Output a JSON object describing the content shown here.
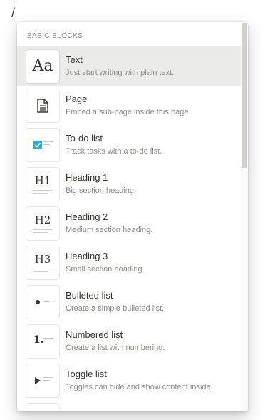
{
  "editor": {
    "typed_text": "/"
  },
  "menu": {
    "section_label": "BASIC BLOCKS",
    "items": [
      {
        "title": "Text",
        "description": "Just start writing with plain text.",
        "icon": "text-block-icon",
        "glyph": "Aa",
        "selected": true
      },
      {
        "title": "Page",
        "description": "Embed a sub-page inside this page.",
        "icon": "page-icon",
        "selected": false
      },
      {
        "title": "To-do list",
        "description": "Track tasks with a to-do list.",
        "icon": "checkbox-icon",
        "selected": false
      },
      {
        "title": "Heading 1",
        "description": "Big section heading.",
        "icon": "heading-1-icon",
        "glyph": "H1",
        "selected": false
      },
      {
        "title": "Heading 2",
        "description": "Medium section heading.",
        "icon": "heading-2-icon",
        "glyph": "H2",
        "selected": false
      },
      {
        "title": "Heading 3",
        "description": "Small section heading.",
        "icon": "heading-3-icon",
        "glyph": "H3",
        "selected": false
      },
      {
        "title": "Bulleted list",
        "description": "Create a simple bulleted list.",
        "icon": "bullet-list-icon",
        "selected": false
      },
      {
        "title": "Numbered list",
        "description": "Create a list with numbering.",
        "icon": "numbered-list-icon",
        "glyph": "1.",
        "selected": false
      },
      {
        "title": "Toggle list",
        "description": "Toggles can hide and show content inside.",
        "icon": "toggle-list-icon",
        "selected": false
      }
    ]
  },
  "colors": {
    "selected_bg": "#ebebea",
    "checkbox_blue": "#2eaadc",
    "text": "#37352f",
    "muted": "#8f8d88"
  }
}
